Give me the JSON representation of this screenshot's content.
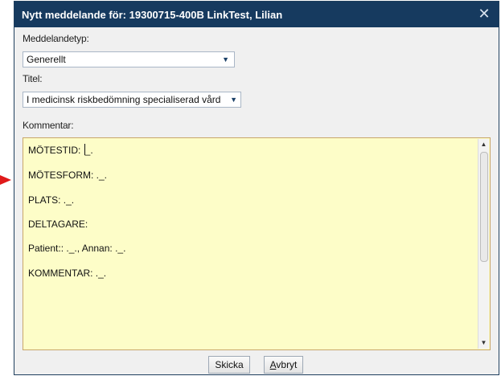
{
  "dialog": {
    "title": "Nytt meddelande för: 19300715-400B LinkTest, Lilian",
    "close_glyph": "✕"
  },
  "form": {
    "type_label": "Meddelandetyp:",
    "type_value": "Generellt",
    "title_label": "Titel:",
    "title_value": "I medicinsk riskbedömning specialiserad vård",
    "comment_label": "Kommentar:",
    "comment_lines": [
      "MÖTESTID: ",
      "MÖTESFORM: ._.",
      "PLATS: ._.",
      "DELTAGARE:",
      "Patient:: ._., Annan: ._.",
      "KOMMENTAR: ._."
    ],
    "first_line_after_cursor": "_."
  },
  "buttons": {
    "send_label": "Skicka",
    "cancel_first_letter": "A",
    "cancel_rest": "vbryt"
  },
  "icons": {
    "dropdown": "▼",
    "scroll_up": "▲",
    "scroll_down": "▼"
  },
  "colors": {
    "titlebar": "#163a5f",
    "comment_bg": "#fdfdc8",
    "arrow": "#e01a1a"
  }
}
